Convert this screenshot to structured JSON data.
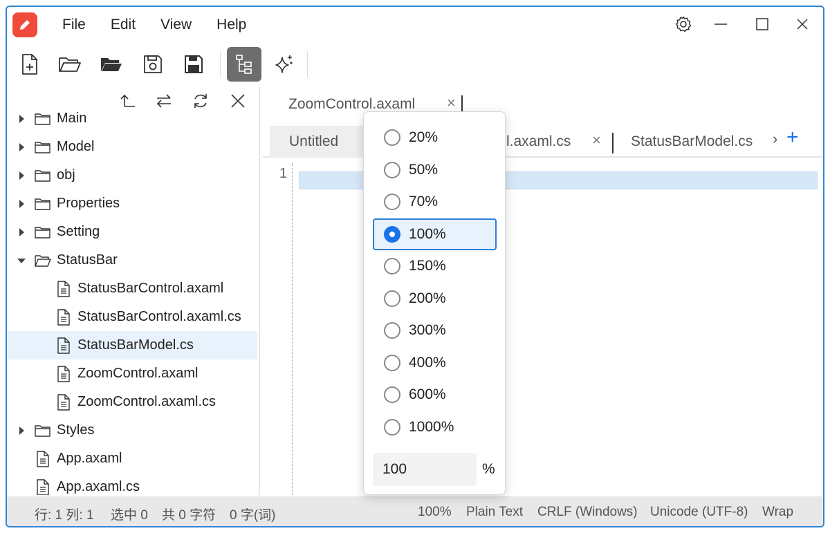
{
  "menu": [
    "File",
    "Edit",
    "View",
    "Help"
  ],
  "sidebar": {
    "tree": [
      {
        "label": "Main",
        "type": "folder",
        "expanded": false,
        "depth": 0
      },
      {
        "label": "Model",
        "type": "folder",
        "expanded": false,
        "depth": 0
      },
      {
        "label": "obj",
        "type": "folder",
        "expanded": false,
        "depth": 0
      },
      {
        "label": "Properties",
        "type": "folder",
        "expanded": false,
        "depth": 0
      },
      {
        "label": "Setting",
        "type": "folder",
        "expanded": false,
        "depth": 0
      },
      {
        "label": "StatusBar",
        "type": "folder",
        "expanded": true,
        "depth": 0
      },
      {
        "label": "StatusBarControl.axaml",
        "type": "file",
        "depth": 1
      },
      {
        "label": "StatusBarControl.axaml.cs",
        "type": "file",
        "depth": 1
      },
      {
        "label": "StatusBarModel.cs",
        "type": "file",
        "depth": 1,
        "selected": true
      },
      {
        "label": "ZoomControl.axaml",
        "type": "file",
        "depth": 1
      },
      {
        "label": "ZoomControl.axaml.cs",
        "type": "file",
        "depth": 1
      },
      {
        "label": "Styles",
        "type": "folder",
        "expanded": false,
        "depth": 0
      },
      {
        "label": "App.axaml",
        "type": "file",
        "depth": 0
      },
      {
        "label": "App.axaml.cs",
        "type": "file",
        "depth": 0
      }
    ]
  },
  "tabs": {
    "row1": [
      {
        "label": "ZoomControl.axaml"
      }
    ],
    "row2": [
      {
        "label": "Untitled"
      },
      {
        "label": "l.axaml.cs"
      },
      {
        "label": "StatusBarModel.cs"
      }
    ],
    "close_glyph": "×",
    "add_glyph": "+",
    "more_glyph": "›"
  },
  "editor": {
    "line_number": "1"
  },
  "zoom": {
    "options": [
      "20%",
      "50%",
      "70%",
      "100%",
      "150%",
      "200%",
      "300%",
      "400%",
      "600%",
      "1000%"
    ],
    "selected": "100%",
    "input_value": "100",
    "unit": "%"
  },
  "statusbar": {
    "position": "行: 1  列: 1",
    "selection": "选中 0",
    "chars": "共 0 字符",
    "words": "0 字(词)",
    "zoom": "100%",
    "language": "Plain Text",
    "line_ending": "CRLF (Windows)",
    "encoding": "Unicode (UTF-8)",
    "wrap": "Wrap"
  },
  "colors": {
    "accent": "#1a73e8",
    "logo": "#f04b3a",
    "window_border": "#2f86d6",
    "selection": "#e8f2fc"
  }
}
